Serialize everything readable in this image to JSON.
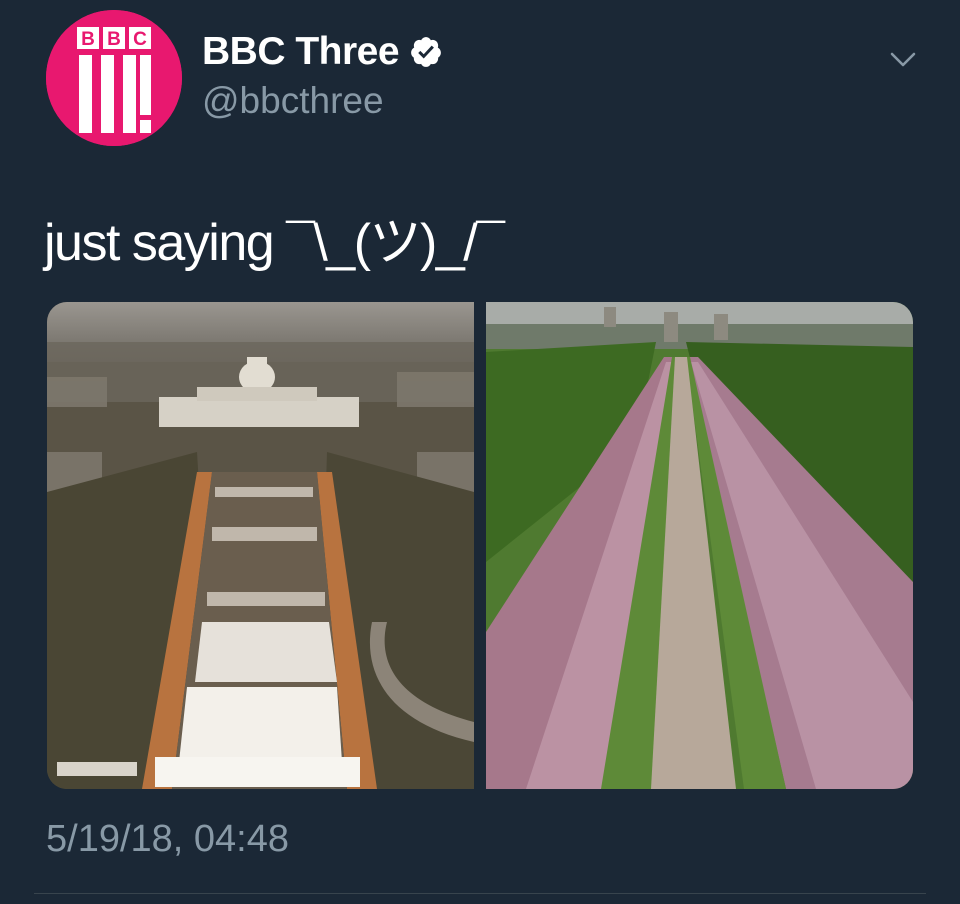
{
  "tweet": {
    "avatar_logo_text": "BBC",
    "display_name": "BBC Three",
    "handle": "@bbcthree",
    "text": "just saying ¯\\_(ツ)_/¯",
    "timestamp": "5/19/18, 04:48"
  },
  "icons": {
    "verified": "verified-badge-icon",
    "menu": "chevron-down-icon"
  },
  "colors": {
    "background": "#1b2836",
    "brand_pink": "#e8186f",
    "secondary_text": "#8899a6"
  }
}
